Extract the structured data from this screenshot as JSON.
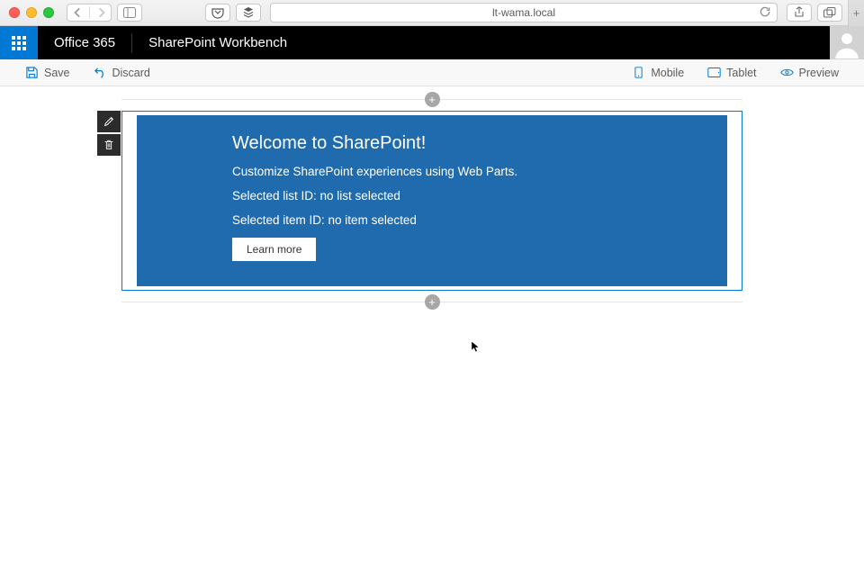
{
  "browser": {
    "address": "lt-wama.local"
  },
  "suite": {
    "brand": "Office 365",
    "appTitle": "SharePoint Workbench"
  },
  "commands": {
    "save": "Save",
    "discard": "Discard",
    "mobile": "Mobile",
    "tablet": "Tablet",
    "preview": "Preview"
  },
  "webpart": {
    "title": "Welcome to SharePoint!",
    "subtitle": "Customize SharePoint experiences using Web Parts.",
    "listLine": "Selected list ID: no list selected",
    "itemLine": "Selected item ID: no item selected",
    "button": "Learn more"
  },
  "icons": {
    "add": "+"
  }
}
